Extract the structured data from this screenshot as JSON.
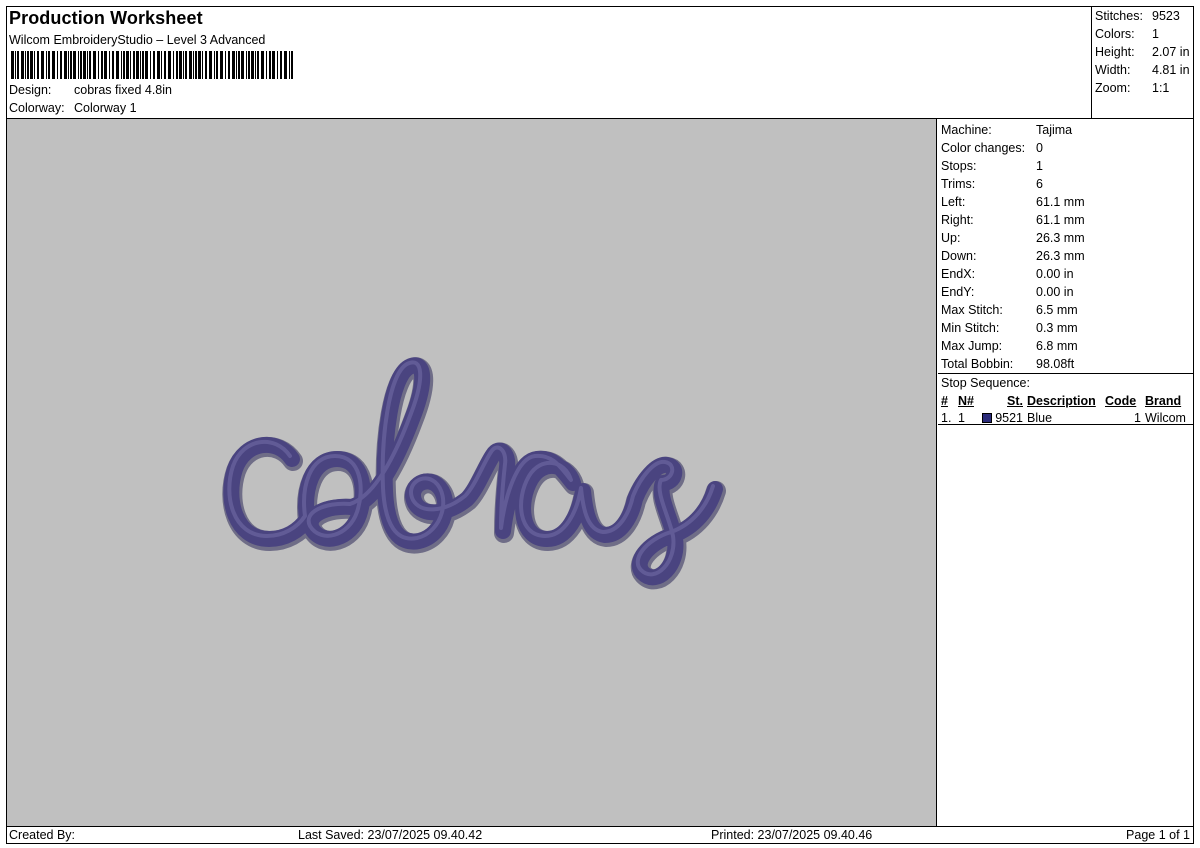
{
  "header": {
    "title": "Production Worksheet",
    "subtitle": "Wilcom EmbroideryStudio – Level 3 Advanced",
    "design_label": "Design:",
    "design_value": "cobras fixed 4.8in",
    "colorway_label": "Colorway:",
    "colorway_value": "Colorway 1"
  },
  "summary": [
    {
      "label": "Stitches:",
      "value": "9523"
    },
    {
      "label": "Colors:",
      "value": "1"
    },
    {
      "label": "Height:",
      "value": "2.07 in"
    },
    {
      "label": "Width:",
      "value": "4.81 in"
    },
    {
      "label": "Zoom:",
      "value": "1:1"
    }
  ],
  "machine": [
    {
      "label": "Machine:",
      "value": "Tajima"
    },
    {
      "label": "Color changes:",
      "value": "0"
    },
    {
      "label": "Stops:",
      "value": "1"
    },
    {
      "label": "Trims:",
      "value": "6"
    },
    {
      "label": "Left:",
      "value": "61.1 mm"
    },
    {
      "label": "Right:",
      "value": "61.1 mm"
    },
    {
      "label": "Up:",
      "value": "26.3 mm"
    },
    {
      "label": "Down:",
      "value": "26.3 mm"
    },
    {
      "label": "EndX:",
      "value": "0.00 in"
    },
    {
      "label": "EndY:",
      "value": "0.00 in"
    },
    {
      "label": "Max Stitch:",
      "value": "6.5 mm"
    },
    {
      "label": "Min Stitch:",
      "value": "0.3 mm"
    },
    {
      "label": "Max Jump:",
      "value": "6.8 mm"
    },
    {
      "label": "Total Bobbin:",
      "value": "98.08ft"
    }
  ],
  "stop_sequence": {
    "caption": "Stop Sequence:",
    "columns": {
      "num": "#",
      "n": "N#",
      "st": "St.",
      "description": "Description",
      "code": "Code",
      "brand": "Brand"
    },
    "rows": [
      {
        "num": "1.",
        "n": "1",
        "st": "9521",
        "description": "Blue",
        "code": "1",
        "brand": "Wilcom",
        "color": "#2b2b7a"
      }
    ]
  },
  "preview": {
    "background": "#c0c0c0",
    "thread_color": "#4a4480"
  },
  "footer": {
    "created_by": "Created By:",
    "last_saved": "Last Saved: 23/07/2025 09.40.42",
    "printed": "Printed: 23/07/2025 09.40.46",
    "page": "Page 1 of 1"
  }
}
